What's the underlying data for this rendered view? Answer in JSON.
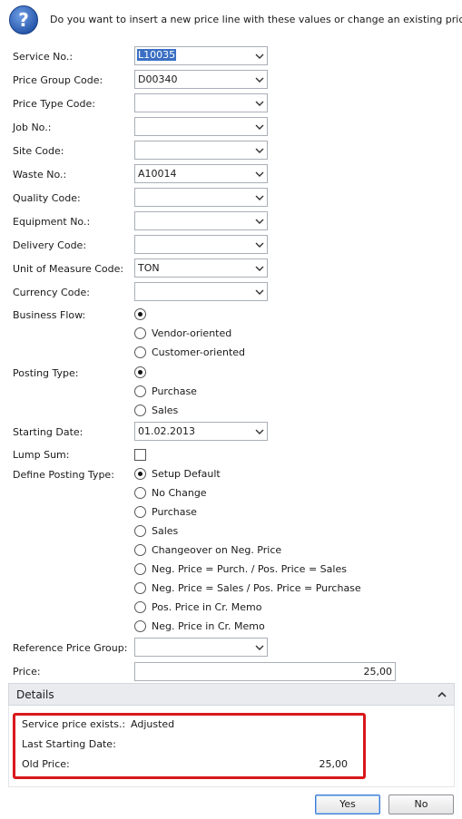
{
  "dialog": {
    "question": "Do you want to insert a new price line with these values or change an existing price?"
  },
  "fields": [
    {
      "label": "Service No.:",
      "value": "L10035",
      "selected": true
    },
    {
      "label": "Price Group Code:",
      "value": "D00340"
    },
    {
      "label": "Price Type Code:",
      "value": ""
    },
    {
      "label": "Job No.:",
      "value": ""
    },
    {
      "label": "Site Code:",
      "value": ""
    },
    {
      "label": "Waste No.:",
      "value": "A10014"
    },
    {
      "label": "Quality Code:",
      "value": ""
    },
    {
      "label": "Equipment No.:",
      "value": ""
    },
    {
      "label": "Delivery Code:",
      "value": ""
    },
    {
      "label": "Unit of Measure Code:",
      "value": "TON"
    },
    {
      "label": "Currency Code:",
      "value": ""
    }
  ],
  "business_flow": {
    "label": "Business Flow:",
    "options": [
      {
        "label": "",
        "selected": true
      },
      {
        "label": "Vendor-oriented",
        "selected": false
      },
      {
        "label": "Customer-oriented",
        "selected": false
      }
    ]
  },
  "posting_type": {
    "label": "Posting Type:",
    "options": [
      {
        "label": "",
        "selected": true
      },
      {
        "label": "Purchase",
        "selected": false
      },
      {
        "label": "Sales",
        "selected": false
      }
    ]
  },
  "starting_date": {
    "label": "Starting Date:",
    "value": "01.02.2013"
  },
  "lump_sum": {
    "label": "Lump Sum:",
    "checked": false
  },
  "define_posting_type": {
    "label": "Define Posting Type:",
    "options": [
      {
        "label": "Setup Default",
        "selected": true
      },
      {
        "label": "No Change",
        "selected": false
      },
      {
        "label": "Purchase",
        "selected": false
      },
      {
        "label": "Sales",
        "selected": false
      },
      {
        "label": "Changeover on Neg. Price",
        "selected": false
      },
      {
        "label": "Neg. Price = Purch. / Pos. Price = Sales",
        "selected": false
      },
      {
        "label": "Neg. Price = Sales / Pos. Price = Purchase",
        "selected": false
      },
      {
        "label": "Pos. Price in Cr. Memo",
        "selected": false
      },
      {
        "label": "Neg. Price in Cr. Memo",
        "selected": false
      }
    ]
  },
  "reference_price_group": {
    "label": "Reference Price Group:",
    "value": ""
  },
  "price": {
    "label": "Price:",
    "value": "25,00"
  },
  "details": {
    "title": "Details",
    "service_price_exists_label": "Service price exists.:",
    "service_price_exists_value": "Adjusted",
    "last_starting_date_label": "Last Starting Date:",
    "last_starting_date_value": "",
    "old_price_label": "Old Price:",
    "old_price_value": "25,00"
  },
  "buttons": {
    "yes": "Yes",
    "no": "No"
  },
  "colors": {
    "highlight": "#d9171c",
    "selection": "#3b6fc4",
    "icon": "#2a5db0"
  }
}
